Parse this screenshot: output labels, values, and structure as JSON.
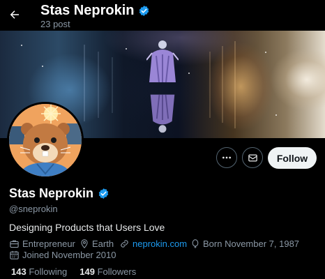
{
  "header": {
    "title": "Stas Neprokin",
    "post_count": "23 post",
    "back_icon": "arrow-left-icon"
  },
  "profile": {
    "name": "Stas Neprokin",
    "handle": "@sneprokin",
    "bio": "Designing Products that Users Love",
    "verified_color": "#1d9bf0",
    "occupation": "Entrepreneur",
    "location": "Earth",
    "website": "neprokin.com",
    "birthday": "Born November 7, 1987",
    "joined": "Joined November 2010",
    "following_count": "143",
    "following_label": "Following",
    "followers_count": "149",
    "followers_label": "Followers"
  },
  "actions": {
    "more_icon": "more-dots-icon",
    "message_icon": "envelope-icon",
    "follow_label": "Follow"
  },
  "colors": {
    "background": "#000000",
    "accent": "#1d9bf0",
    "muted_text": "#8b98a5",
    "follow_button_bg": "#eff3f4"
  }
}
